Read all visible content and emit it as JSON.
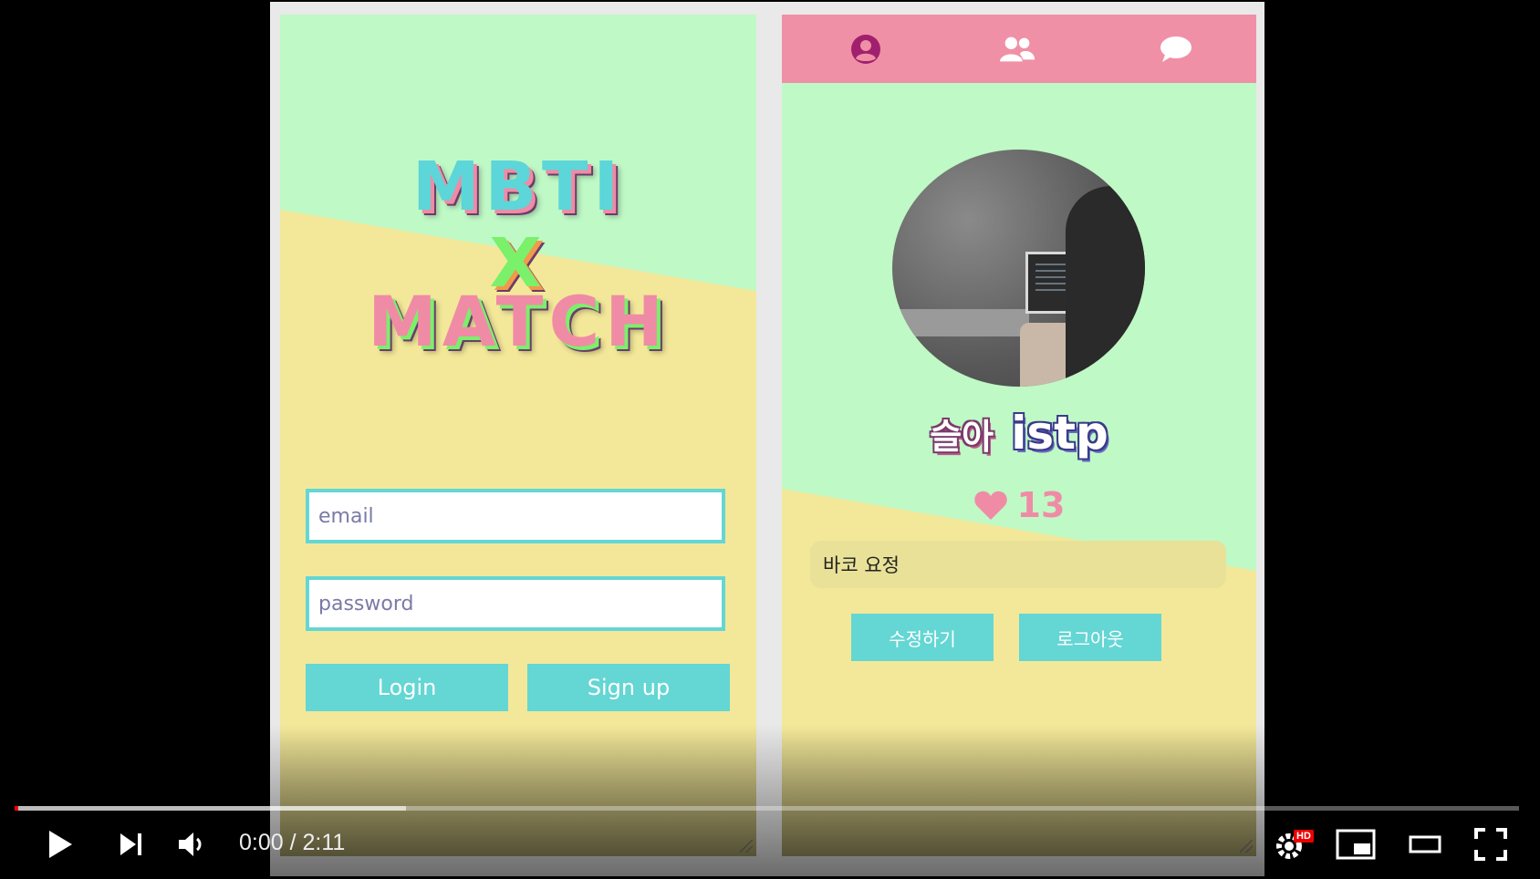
{
  "login_screen": {
    "logo_lines": [
      "MBTI",
      "X",
      "MATCH"
    ],
    "email_placeholder": "email",
    "password_placeholder": "password",
    "login_label": "Login",
    "signup_label": "Sign up"
  },
  "profile_screen": {
    "nav_icons": [
      "profile-icon",
      "friends-icon",
      "chat-icon"
    ],
    "name": "슬아",
    "mbti": "istp",
    "likes": "13",
    "bio": "바코 요정",
    "edit_label": "수정하기",
    "logout_label": "로그아웃"
  },
  "player": {
    "current_time": "0:00",
    "separator": " / ",
    "duration": "2:11",
    "played_fraction": 0.0,
    "buffered_fraction": 0.26,
    "hd_badge": "HD"
  },
  "colors": {
    "mint": "#bff9c6",
    "yellow": "#f3e899",
    "teal": "#64d6d4",
    "pink": "#f090a6"
  }
}
